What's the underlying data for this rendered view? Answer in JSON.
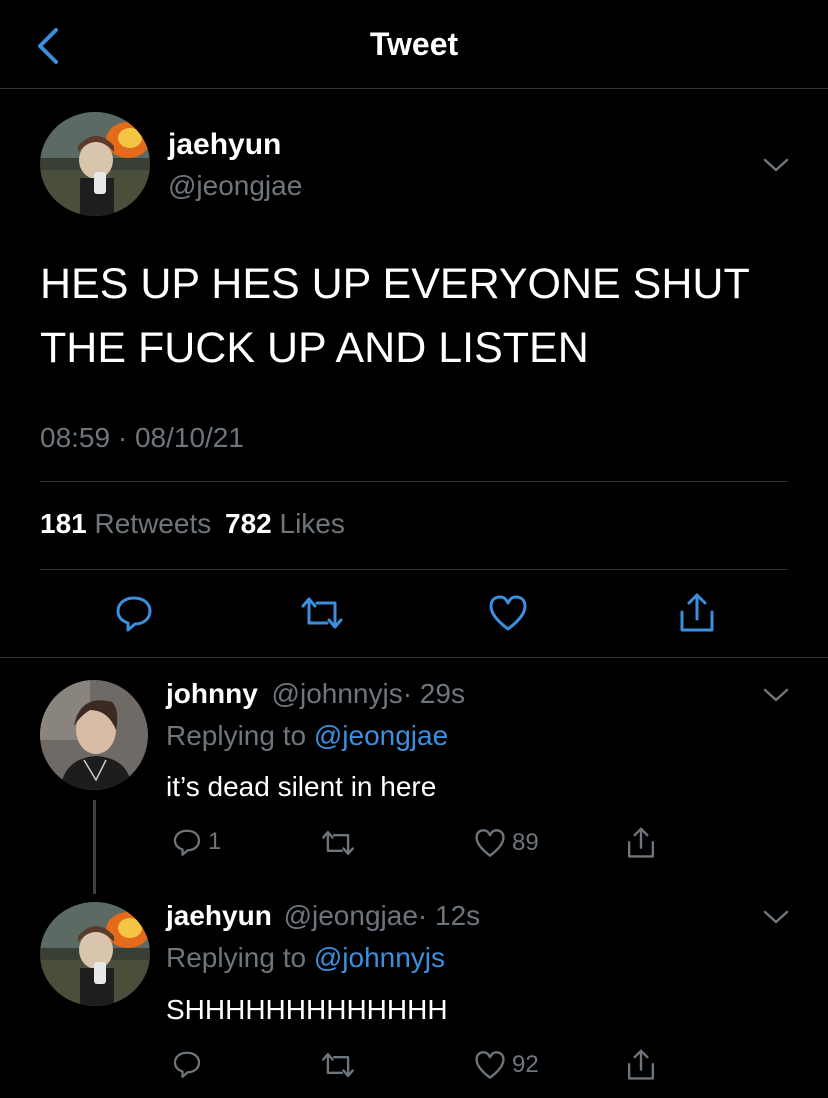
{
  "header": {
    "title": "Tweet",
    "back_icon": "chevron-left-icon"
  },
  "main_tweet": {
    "display_name": "jaehyun",
    "handle": "@jeongjae",
    "text_line1": "HES UP HES UP EVERYONE SHUT",
    "text_line2": "THE FUCK UP AND LISTEN",
    "timestamp": "08:59 · 08/10/21",
    "retweet_count": "181",
    "retweet_label": "Retweets",
    "like_count": "782",
    "like_label": "Likes"
  },
  "replies": [
    {
      "display_name": "johnny",
      "handle": "@johnnyjs",
      "time": "· 29s",
      "replying_prefix": "Replying to",
      "replying_to": "@jeongjae",
      "text": "it’s dead silent in here",
      "reply_count": "1",
      "like_count": "89"
    },
    {
      "display_name": "jaehyun",
      "handle": "@jeongjae",
      "time": "· 12s",
      "replying_prefix": "Replying to",
      "replying_to": "@johnnyjs",
      "text": "SHHHHHHHHHHHHH",
      "reply_count": "",
      "like_count": "92"
    }
  ],
  "colors": {
    "background": "#000000",
    "text": "#ffffff",
    "muted": "#6e767d",
    "accent": "#3c8fdd",
    "divider": "#2f3336"
  }
}
